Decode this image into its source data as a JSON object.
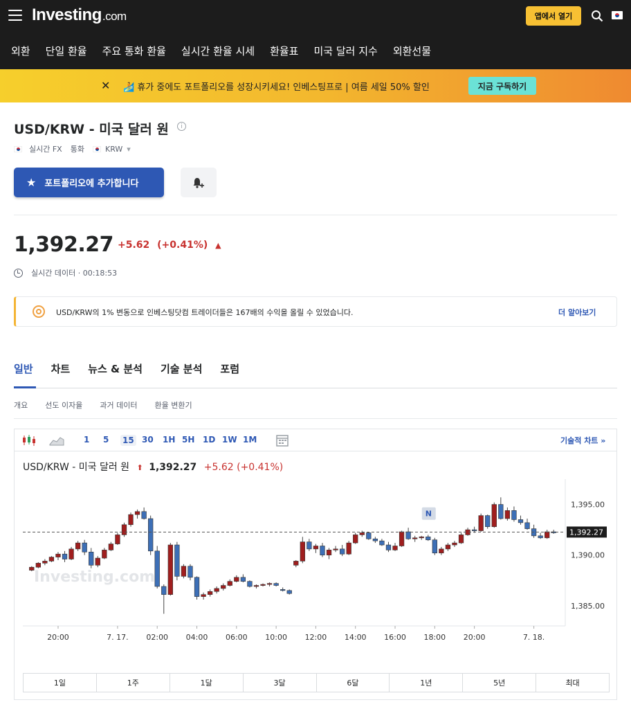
{
  "header": {
    "logo_main": "Investing",
    "logo_suffix": ".com",
    "open_app_label": "앱에서 열기"
  },
  "nav": {
    "items": [
      "외환",
      "단일 환율",
      "주요 통화 환율",
      "실시간 환율 시세",
      "환율표",
      "미국 달러 지수",
      "외환선물"
    ]
  },
  "promo": {
    "close": "✕",
    "message": "🏄 휴가 중에도 포트폴리오를 성장시키세요! 인베스팅프로 | 여름 세일 50% 할인",
    "cta": "지금 구독하기"
  },
  "instrument": {
    "title": "USD/KRW - 미국 달러 원",
    "info_glyph": "i",
    "meta_realtime": "실시간 FX",
    "meta_currency": "통화",
    "meta_code": "KRW",
    "meta_caret": "▾",
    "add_portfolio": "포트폴리오에 추가합니다",
    "price": "1,392.27",
    "change": "+5.62",
    "change_pct": "(+0.41%)",
    "change_dir": "▲",
    "realtime_label": "실시간 데이터 · 00:18:53"
  },
  "info_banner": {
    "text": "USD/KRW의 1% 변동으로 인베스팅닷컴 트레이더들은 167배의 수익을 올릴 수 있었습니다.",
    "more": "더 알아보기"
  },
  "tabs": [
    "일반",
    "차트",
    "뉴스 & 분석",
    "기술 분석",
    "포럼"
  ],
  "subtabs": [
    "개요",
    "선도 이자율",
    "과거 데이터",
    "환율 변환기"
  ],
  "chart_toolbar": {
    "intervals": [
      "1",
      "5",
      "15",
      "30",
      "1H",
      "5H",
      "1D",
      "1W",
      "1M"
    ],
    "selected": "15",
    "tech_chart": "기술적 차트 »"
  },
  "chart_header": {
    "name": "USD/KRW - 미국 달러 원",
    "arrow": "⬆",
    "price": "1,392.27",
    "change": "+5.62 (+0.41%)"
  },
  "ranges": [
    "1일",
    "1주",
    "1달",
    "3달",
    "6달",
    "1년",
    "5년",
    "최대"
  ],
  "chart_data": {
    "type": "candlestick",
    "watermark": "Investing.com",
    "event_marker": "N",
    "last_price_label": "1,392.27",
    "last_price": 1392.27,
    "ylim": [
      1383.0,
      1397.5
    ],
    "y_ticks": [
      1385.0,
      1390.0,
      1395.0
    ],
    "y_tick_labels": [
      "1,385.00",
      "1,390.00",
      "1,395.00"
    ],
    "x_tick_labels": [
      "20:00",
      "7. 17.",
      "02:00",
      "04:00",
      "06:00",
      "10:00",
      "12:00",
      "14:00",
      "16:00",
      "18:00",
      "20:00",
      "7. 18."
    ],
    "candles": [
      [
        1388.5,
        1388.9,
        1388.4,
        1388.8
      ],
      [
        1388.8,
        1389.3,
        1388.7,
        1389.2
      ],
      [
        1389.2,
        1389.6,
        1389.0,
        1389.4
      ],
      [
        1389.4,
        1389.9,
        1389.3,
        1389.8
      ],
      [
        1389.8,
        1390.3,
        1389.5,
        1390.1
      ],
      [
        1390.1,
        1390.4,
        1389.3,
        1389.6
      ],
      [
        1389.6,
        1390.8,
        1389.5,
        1390.6
      ],
      [
        1390.6,
        1391.4,
        1390.4,
        1391.2
      ],
      [
        1391.2,
        1391.5,
        1390.0,
        1390.3
      ],
      [
        1390.3,
        1390.7,
        1388.7,
        1389.0
      ],
      [
        1389.0,
        1389.9,
        1388.8,
        1389.7
      ],
      [
        1389.7,
        1390.7,
        1389.6,
        1390.5
      ],
      [
        1390.5,
        1391.3,
        1390.4,
        1391.1
      ],
      [
        1391.1,
        1392.2,
        1391.0,
        1392.0
      ],
      [
        1392.0,
        1393.2,
        1391.8,
        1393.0
      ],
      [
        1393.0,
        1394.2,
        1392.8,
        1394.0
      ],
      [
        1394.0,
        1394.5,
        1393.6,
        1394.3
      ],
      [
        1394.3,
        1394.7,
        1393.5,
        1393.6
      ],
      [
        1393.6,
        1393.9,
        1390.0,
        1390.4
      ],
      [
        1390.4,
        1390.9,
        1386.7,
        1386.9
      ],
      [
        1386.9,
        1387.1,
        1384.2,
        1386.1
      ],
      [
        1386.1,
        1391.2,
        1386.0,
        1391.0
      ],
      [
        1391.0,
        1391.3,
        1387.5,
        1387.9
      ],
      [
        1387.9,
        1389.1,
        1387.7,
        1388.9
      ],
      [
        1388.9,
        1389.1,
        1387.5,
        1387.8
      ],
      [
        1387.8,
        1387.9,
        1385.6,
        1385.9
      ],
      [
        1385.9,
        1386.3,
        1385.6,
        1386.1
      ],
      [
        1386.1,
        1386.6,
        1385.9,
        1386.4
      ],
      [
        1386.4,
        1386.9,
        1386.2,
        1386.7
      ],
      [
        1386.7,
        1387.2,
        1386.5,
        1387.0
      ],
      [
        1387.0,
        1387.6,
        1386.9,
        1387.4
      ],
      [
        1387.4,
        1388.0,
        1387.3,
        1387.8
      ],
      [
        1387.8,
        1388.1,
        1387.3,
        1387.4
      ],
      [
        1387.4,
        1387.5,
        1386.8,
        1386.9
      ],
      [
        1386.9,
        1387.1,
        1386.7,
        1387.0
      ],
      [
        1387.0,
        1387.2,
        1386.9,
        1387.1
      ],
      [
        1387.1,
        1387.3,
        1386.9,
        1387.2
      ],
      [
        1387.2,
        1387.3,
        1386.9,
        1387.0
      ],
      [
        1386.6,
        1386.8,
        1386.4,
        1386.5
      ],
      [
        1386.5,
        1386.6,
        1386.1,
        1386.2
      ],
      [
        1389.0,
        1389.5,
        1388.8,
        1389.4
      ],
      [
        1389.4,
        1391.8,
        1389.2,
        1391.3
      ],
      [
        1391.3,
        1391.6,
        1390.4,
        1390.6
      ],
      [
        1390.6,
        1391.1,
        1390.2,
        1390.9
      ],
      [
        1390.9,
        1391.2,
        1389.8,
        1390.0
      ],
      [
        1390.0,
        1390.7,
        1389.6,
        1390.5
      ],
      [
        1390.5,
        1390.9,
        1390.3,
        1390.6
      ],
      [
        1390.6,
        1391.0,
        1389.9,
        1390.1
      ],
      [
        1390.1,
        1391.4,
        1390.0,
        1391.2
      ],
      [
        1391.2,
        1392.2,
        1391.1,
        1392.0
      ],
      [
        1392.0,
        1392.4,
        1391.8,
        1392.2
      ],
      [
        1392.2,
        1392.3,
        1391.5,
        1391.6
      ],
      [
        1391.6,
        1391.8,
        1391.2,
        1391.4
      ],
      [
        1391.4,
        1391.6,
        1390.9,
        1391.0
      ],
      [
        1391.0,
        1391.3,
        1390.3,
        1390.5
      ],
      [
        1390.5,
        1391.2,
        1390.4,
        1390.9
      ],
      [
        1390.9,
        1392.4,
        1390.8,
        1392.3
      ],
      [
        1392.3,
        1392.7,
        1391.5,
        1391.6
      ],
      [
        1391.6,
        1391.9,
        1391.3,
        1391.7
      ],
      [
        1391.7,
        1391.9,
        1391.5,
        1391.8
      ],
      [
        1391.8,
        1392.0,
        1391.4,
        1391.5
      ],
      [
        1391.5,
        1391.7,
        1390.0,
        1390.2
      ],
      [
        1390.2,
        1390.8,
        1390.0,
        1390.6
      ],
      [
        1390.6,
        1391.2,
        1390.4,
        1391.0
      ],
      [
        1391.0,
        1391.4,
        1390.8,
        1391.2
      ],
      [
        1391.2,
        1392.2,
        1391.1,
        1392.0
      ],
      [
        1392.0,
        1392.7,
        1391.9,
        1392.5
      ],
      [
        1392.5,
        1392.8,
        1392.2,
        1392.4
      ],
      [
        1392.4,
        1394.1,
        1392.3,
        1393.9
      ],
      [
        1393.9,
        1394.0,
        1392.6,
        1392.8
      ],
      [
        1392.8,
        1395.2,
        1392.7,
        1395.0
      ],
      [
        1395.0,
        1395.7,
        1393.5,
        1393.6
      ],
      [
        1393.6,
        1394.7,
        1393.4,
        1394.4
      ],
      [
        1394.4,
        1394.8,
        1393.3,
        1393.5
      ],
      [
        1393.5,
        1393.9,
        1393.0,
        1393.2
      ],
      [
        1393.2,
        1393.6,
        1392.5,
        1392.6
      ],
      [
        1392.6,
        1393.0,
        1391.7,
        1391.9
      ],
      [
        1391.9,
        1392.2,
        1391.6,
        1391.7
      ],
      [
        1391.7,
        1392.5,
        1391.6,
        1392.3
      ],
      [
        1392.3,
        1392.5,
        1392.1,
        1392.27
      ]
    ]
  }
}
